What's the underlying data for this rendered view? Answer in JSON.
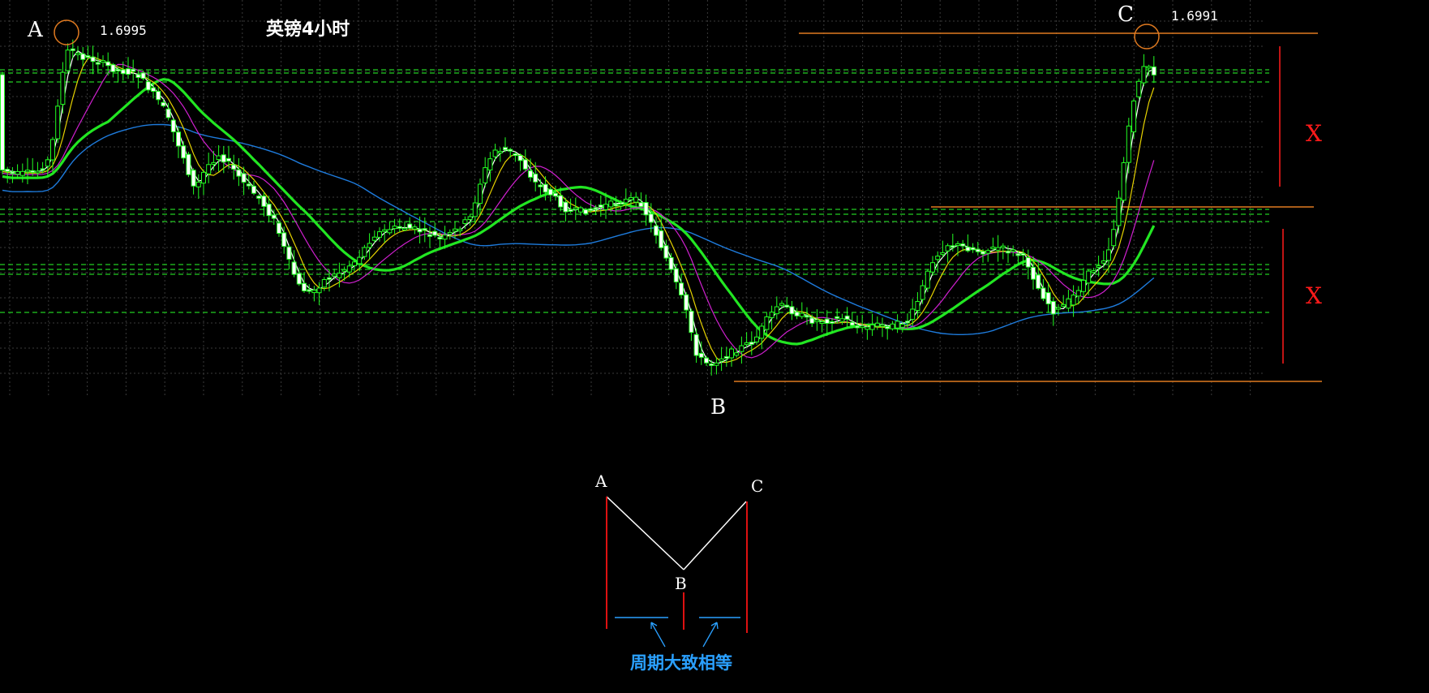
{
  "chart_data": {
    "type": "candlestick",
    "title": "英镑4小时",
    "points": [
      {
        "label": "A",
        "price": "1.6995"
      },
      {
        "label": "B",
        "price": ""
      },
      {
        "label": "C",
        "price": "1.6991"
      }
    ],
    "swing_label": "X",
    "diagram": {
      "labels": [
        "A",
        "B",
        "C"
      ],
      "note": "周期大致相等"
    },
    "colors": {
      "background": "#000000",
      "grid": "#3a3a3a",
      "candle_up": "#000000",
      "candle_down": "#ffffff",
      "wick": "#22ff22",
      "ma_fast": "#ffffff",
      "ma_yellow": "#e6d200",
      "ma_magenta": "#d020d0",
      "ma_green": "#22e622",
      "ma_blue": "#1e7bdc",
      "level_lines": "#22cc22",
      "horizontal_ref": "#e07a20",
      "x_mark": "#ff1a1a",
      "note": "#2aa0ff"
    }
  }
}
